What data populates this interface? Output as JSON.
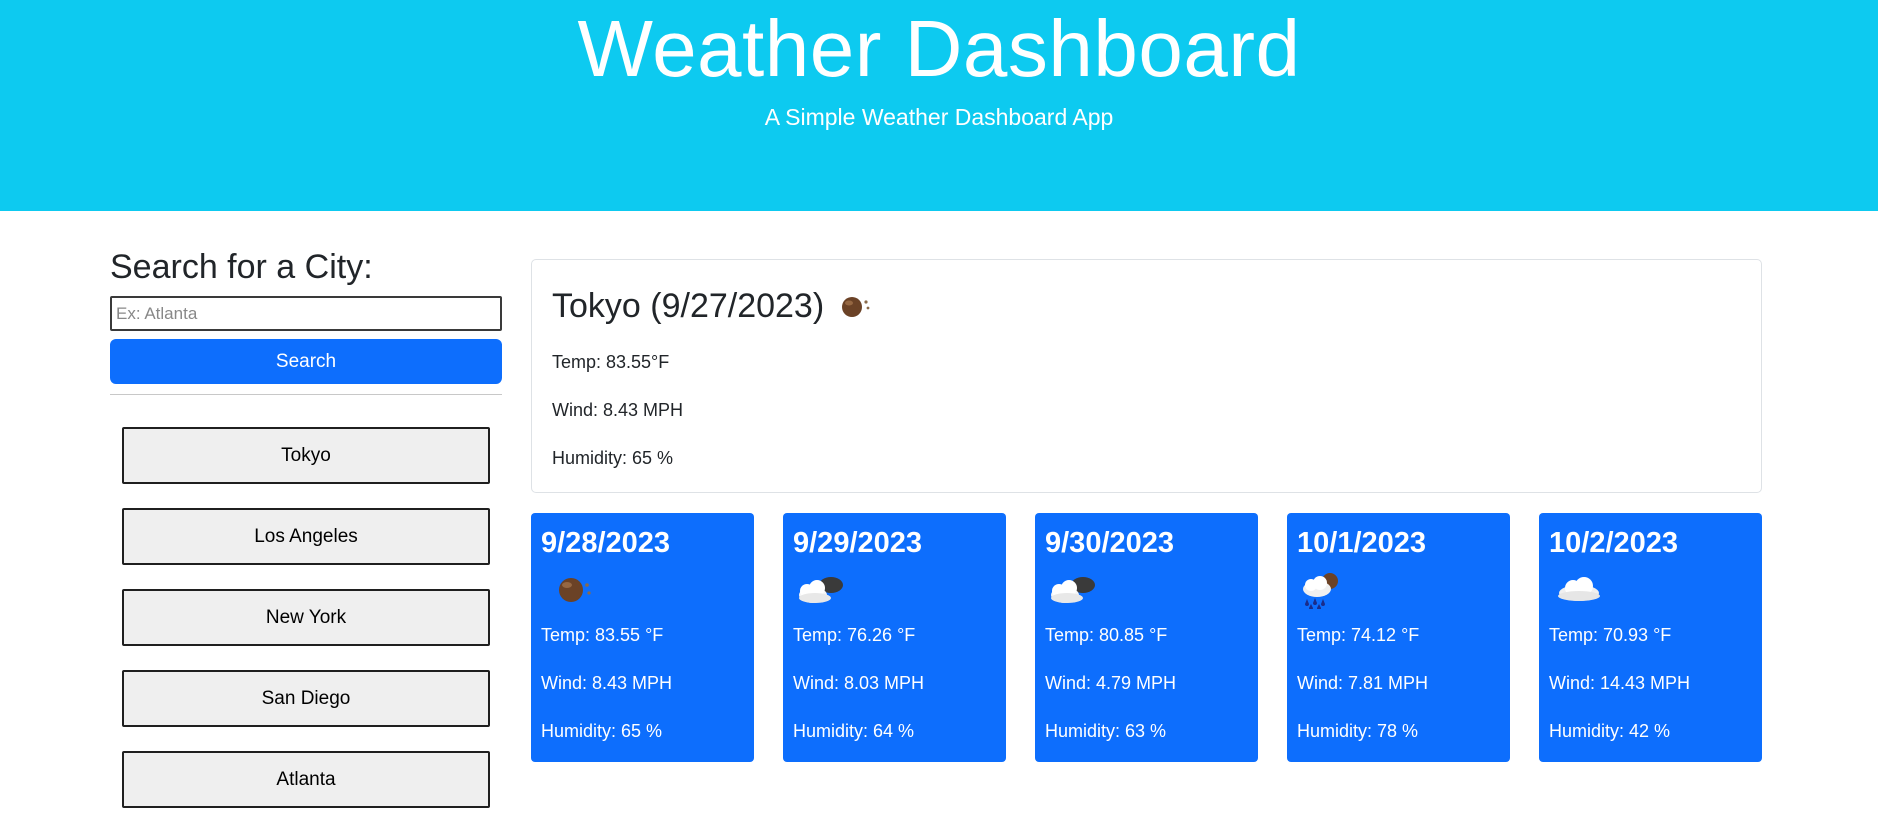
{
  "header": {
    "title": "Weather Dashboard",
    "subtitle": "A Simple Weather Dashboard App",
    "bg_color": "#0dcaf0"
  },
  "search": {
    "heading": "Search for a City:",
    "placeholder": "Ex: Atlanta",
    "button_label": "Search",
    "button_color": "#0d6efd"
  },
  "history": [
    {
      "label": "Tokyo"
    },
    {
      "label": "Los Angeles"
    },
    {
      "label": "New York"
    },
    {
      "label": "San Diego"
    },
    {
      "label": "Atlanta"
    }
  ],
  "current": {
    "title": "Tokyo (9/27/2023)",
    "icon": "haze-icon",
    "temp": "Temp: 83.55°F",
    "wind": "Wind: 8.43 MPH",
    "humidity": "Humidity: 65 %"
  },
  "forecast": [
    {
      "date": "9/28/2023",
      "icon": "haze-icon",
      "temp": "Temp: 83.55 °F",
      "wind": "Wind: 8.43 MPH",
      "humidity": "Humidity: 65 %"
    },
    {
      "date": "9/29/2023",
      "icon": "broken-clouds-icon",
      "temp": "Temp: 76.26 °F",
      "wind": "Wind: 8.03 MPH",
      "humidity": "Humidity: 64 %"
    },
    {
      "date": "9/30/2023",
      "icon": "broken-clouds-icon",
      "temp": "Temp: 80.85 °F",
      "wind": "Wind: 4.79 MPH",
      "humidity": "Humidity: 63 %"
    },
    {
      "date": "10/1/2023",
      "icon": "rain-icon",
      "temp": "Temp: 74.12 °F",
      "wind": "Wind: 7.81 MPH",
      "humidity": "Humidity: 78 %"
    },
    {
      "date": "10/2/2023",
      "icon": "cloud-icon",
      "temp": "Temp: 70.93 °F",
      "wind": "Wind: 14.43 MPH",
      "humidity": "Humidity: 42 %"
    }
  ]
}
